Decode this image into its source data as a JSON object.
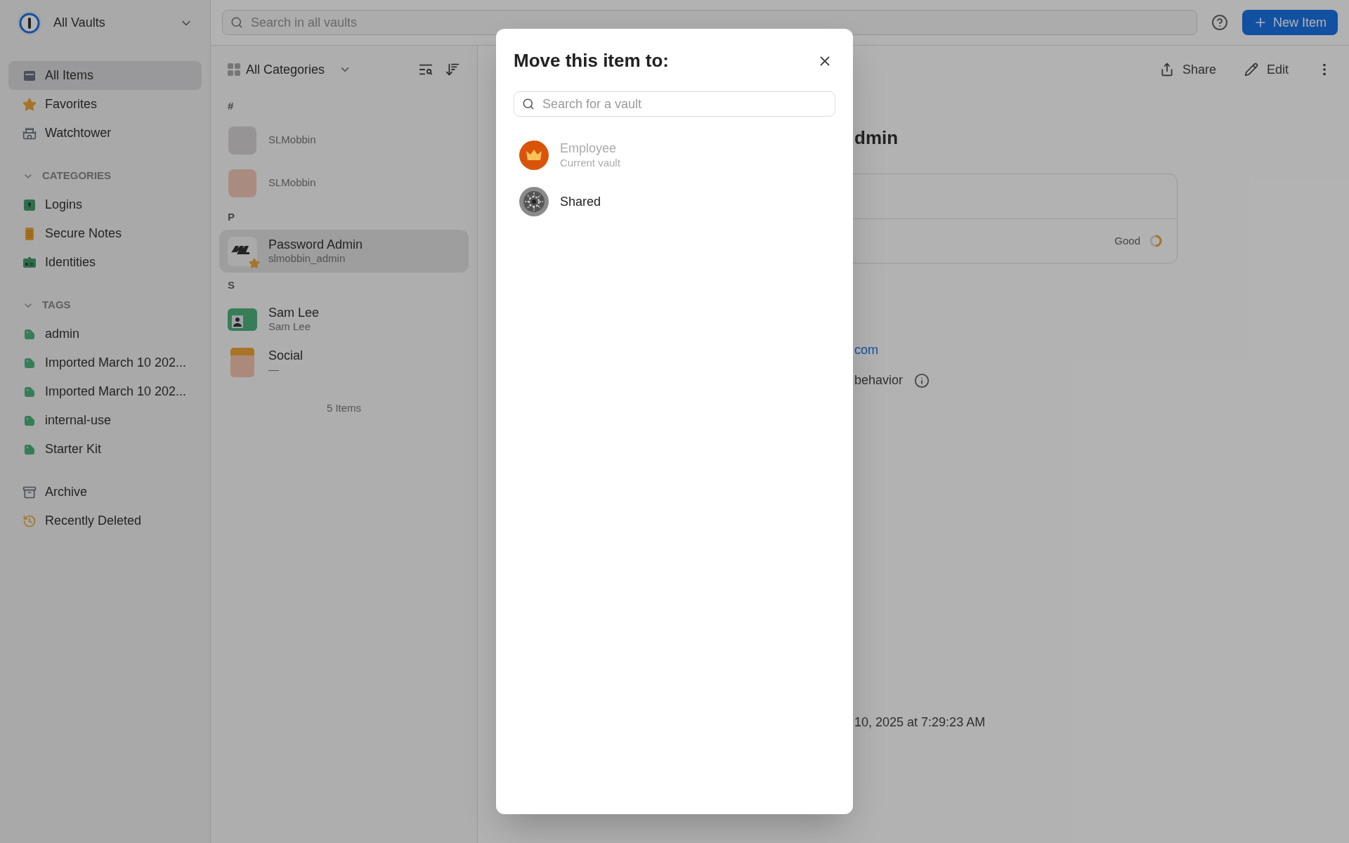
{
  "vault_switcher": {
    "label": "All Vaults"
  },
  "search": {
    "placeholder": "Search in all vaults"
  },
  "new_item_button": {
    "label": "New Item"
  },
  "sidebar": {
    "items": [
      {
        "label": "All Items",
        "kind": "all",
        "selected": true
      },
      {
        "label": "Favorites",
        "kind": "star",
        "selected": false
      },
      {
        "label": "Watchtower",
        "kind": "tower",
        "selected": false
      }
    ],
    "sections": [
      {
        "title": "CATEGORIES",
        "expanded": true,
        "items": [
          {
            "label": "Logins",
            "kind": "login",
            "selected": false
          },
          {
            "label": "Secure Notes",
            "kind": "note",
            "selected": false
          },
          {
            "label": "Identities",
            "kind": "identity",
            "selected": false
          }
        ]
      },
      {
        "title": "TAGS",
        "expanded": true,
        "items": [
          {
            "label": "admin",
            "kind": "tag",
            "selected": false
          },
          {
            "label": "Imported March 10 202...",
            "kind": "tag",
            "selected": false
          },
          {
            "label": "Imported March 10 202...",
            "kind": "tag",
            "selected": false
          },
          {
            "label": "internal-use",
            "kind": "tag",
            "selected": false
          },
          {
            "label": "Starter Kit",
            "kind": "tag",
            "selected": false
          }
        ]
      }
    ],
    "bottom_items": [
      {
        "label": "Archive",
        "kind": "archive",
        "selected": false
      },
      {
        "label": "Recently Deleted",
        "kind": "deleted",
        "selected": false
      }
    ]
  },
  "item_list": {
    "filter": "All Categories",
    "groups": [
      {
        "letter": "#",
        "items": [
          {
            "title": "SLMobbin",
            "kind": "blank-gray",
            "selected": false,
            "favorite": false
          },
          {
            "title": "SLMobbin",
            "kind": "blank-peach",
            "selected": false,
            "favorite": false
          }
        ]
      },
      {
        "letter": "P",
        "items": [
          {
            "title": "Password Admin",
            "subtitle": "slmobbin_admin",
            "kind": "logo",
            "selected": true,
            "favorite": true
          }
        ]
      },
      {
        "letter": "S",
        "items": [
          {
            "title": "Sam Lee",
            "subtitle": "Sam Lee",
            "kind": "identity",
            "selected": false,
            "favorite": false
          },
          {
            "title": "Social",
            "subtitle": "—",
            "kind": "note",
            "selected": false,
            "favorite": false
          }
        ]
      }
    ],
    "count": "5 Items"
  },
  "detail": {
    "actions": [
      {
        "label": "Share",
        "kind": "share"
      },
      {
        "label": "Edit",
        "kind": "edit"
      }
    ],
    "title": "dmin",
    "strength": "Good",
    "website": "com",
    "autofill": "behavior",
    "modified": "10, 2025 at 7:29:23 AM"
  },
  "dialog": {
    "title": "Move this item to:",
    "search_placeholder": "Search for a vault",
    "vaults": [
      {
        "name": "Employee",
        "subtitle": "Current vault",
        "kind": "crown",
        "disabled": true
      },
      {
        "name": "Shared",
        "kind": "wheel",
        "disabled": false
      }
    ]
  }
}
